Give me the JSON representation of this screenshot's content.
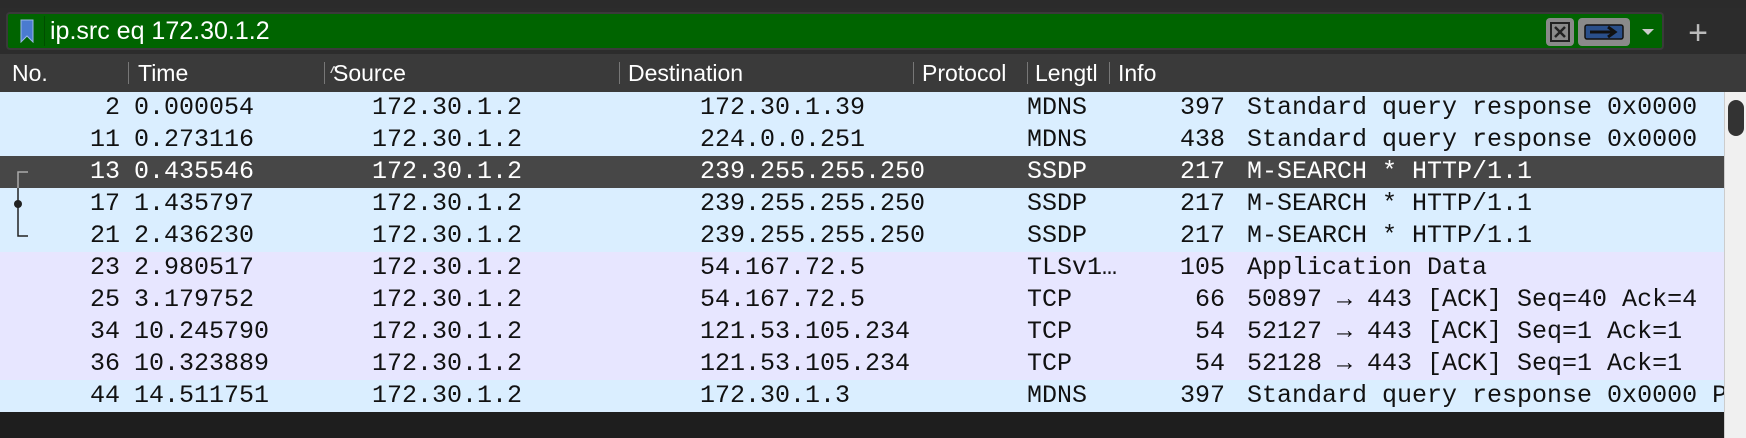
{
  "filter": {
    "value": "ip.src eq 172.30.1.2"
  },
  "icons": {
    "bookmark": "bookmark-icon",
    "clear": "clear-x-icon",
    "apply": "arrow-right-icon",
    "dropdown": "chevron-down-icon",
    "add": "plus-icon"
  },
  "toolbar": {
    "add_label": "+"
  },
  "columns": {
    "no": "No.",
    "time": "Time",
    "time_sort": "^",
    "source": "Source",
    "destination": "Destination",
    "protocol": "Protocol",
    "length": "Lengtl",
    "info": "Info"
  },
  "colors": {
    "filter_bg": "#006400",
    "mdns_row": "#daeeff",
    "tcp_row": "#e7e6ff",
    "selected_row": "#474747"
  },
  "packets": [
    {
      "no": "2",
      "time": "0.000054",
      "source": "172.30.1.2",
      "destination": "172.30.1.39",
      "protocol": "MDNS",
      "length": "397",
      "info": "Standard query response 0x0000"
    },
    {
      "no": "11",
      "time": "0.273116",
      "source": "172.30.1.2",
      "destination": "224.0.0.251",
      "protocol": "MDNS",
      "length": "438",
      "info": "Standard query response 0x0000"
    },
    {
      "no": "13",
      "time": "0.435546",
      "source": "172.30.1.2",
      "destination": "239.255.255.250",
      "protocol": "SSDP",
      "length": "217",
      "info": "M-SEARCH * HTTP/1.1"
    },
    {
      "no": "17",
      "time": "1.435797",
      "source": "172.30.1.2",
      "destination": "239.255.255.250",
      "protocol": "SSDP",
      "length": "217",
      "info": "M-SEARCH * HTTP/1.1"
    },
    {
      "no": "21",
      "time": "2.436230",
      "source": "172.30.1.2",
      "destination": "239.255.255.250",
      "protocol": "SSDP",
      "length": "217",
      "info": "M-SEARCH * HTTP/1.1"
    },
    {
      "no": "23",
      "time": "2.980517",
      "source": "172.30.1.2",
      "destination": "54.167.72.5",
      "protocol": "TLSv1…",
      "length": "105",
      "info": "Application Data"
    },
    {
      "no": "25",
      "time": "3.179752",
      "source": "172.30.1.2",
      "destination": "54.167.72.5",
      "protocol": "TCP",
      "length": "66",
      "info": "50897 → 443 [ACK] Seq=40 Ack=4"
    },
    {
      "no": "34",
      "time": "10.245790",
      "source": "172.30.1.2",
      "destination": "121.53.105.234",
      "protocol": "TCP",
      "length": "54",
      "info": "52127 → 443 [ACK] Seq=1 Ack=1"
    },
    {
      "no": "36",
      "time": "10.323889",
      "source": "172.30.1.2",
      "destination": "121.53.105.234",
      "protocol": "TCP",
      "length": "54",
      "info": "52128 → 443 [ACK] Seq=1 Ack=1"
    },
    {
      "no": "44",
      "time": "14.511751",
      "source": "172.30.1.2",
      "destination": "172.30.1.3",
      "protocol": "MDNS",
      "length": "397",
      "info": "Standard query response 0x0000 P"
    }
  ]
}
